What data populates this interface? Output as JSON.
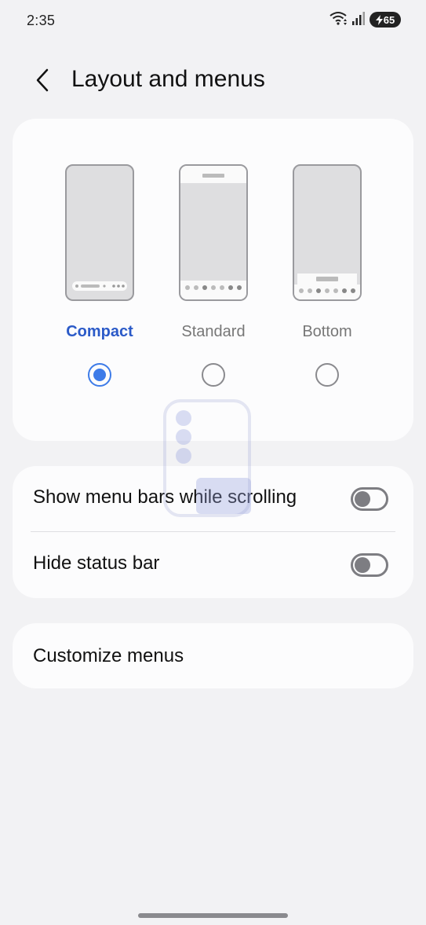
{
  "status_bar": {
    "time": "2:35",
    "battery_level": "65",
    "icons": [
      "wifi-icon",
      "signal-icon",
      "battery-charging-icon"
    ]
  },
  "header": {
    "title": "Layout and menus",
    "back_icon": "chevron-left-icon"
  },
  "layout_options": [
    {
      "label": "Compact",
      "selected": true
    },
    {
      "label": "Standard",
      "selected": false
    },
    {
      "label": "Bottom",
      "selected": false
    }
  ],
  "toggles": [
    {
      "label": "Show menu bars while scrolling",
      "on": false
    },
    {
      "label": "Hide status bar",
      "on": false
    }
  ],
  "customize": {
    "label": "Customize menus"
  },
  "colors": {
    "accent": "#3d7be8",
    "selected_label": "#2b5ac8",
    "background": "#f2f2f4",
    "card": "#fcfcfd"
  }
}
